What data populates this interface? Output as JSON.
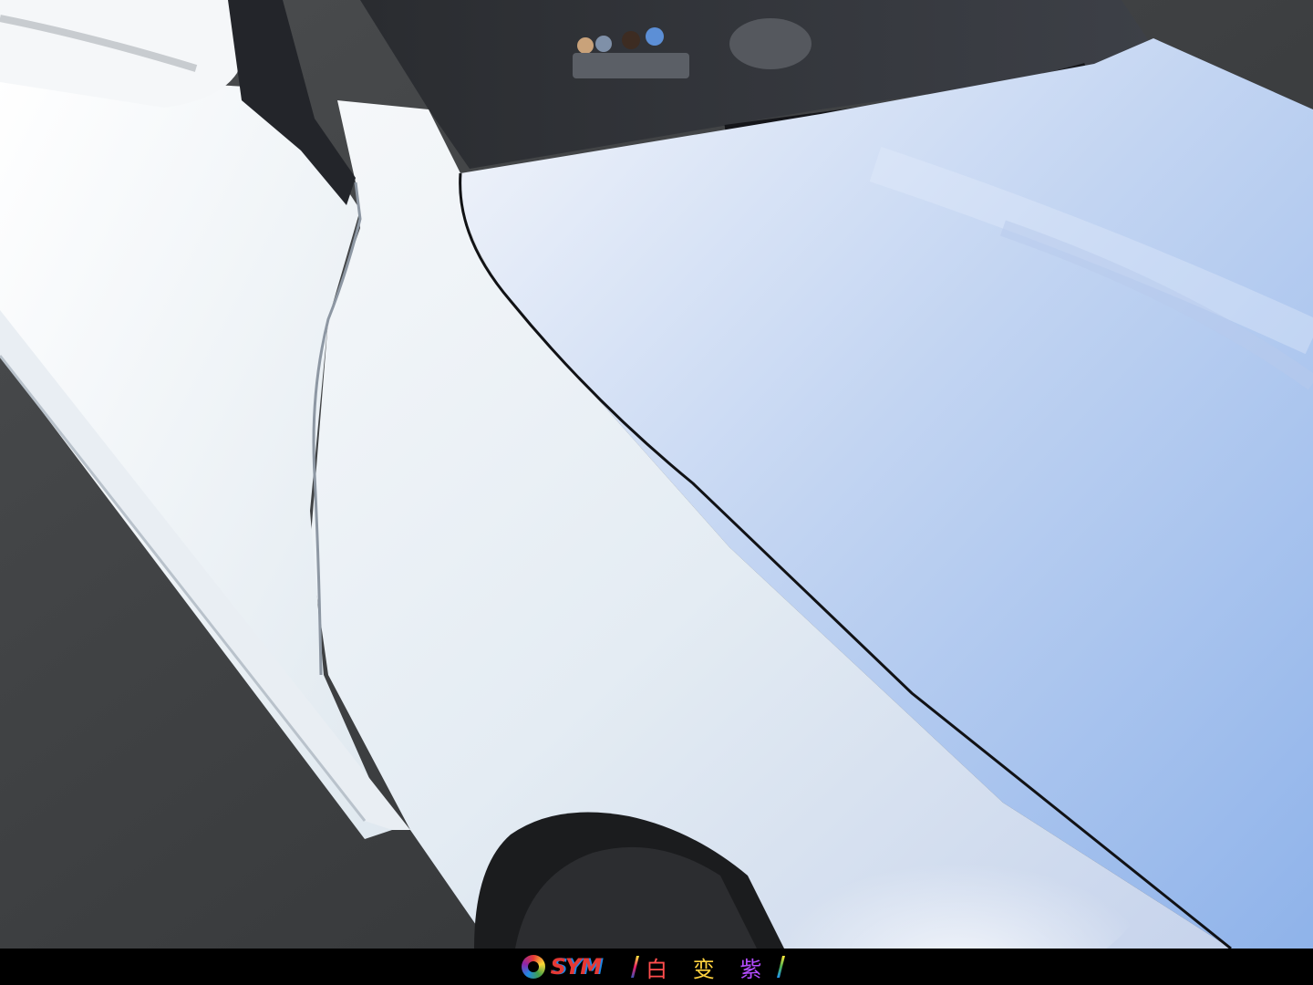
{
  "scene": {
    "description_icon": "white-car-fender-photo"
  },
  "footer": {
    "brand": "SYM",
    "tagline": [
      "白",
      "变",
      "紫"
    ],
    "colors": {
      "brand_red": "#e53935",
      "brand_blue": "#1e88e5",
      "char1": "#ff4d4d",
      "char2": "#ffd23f",
      "char3": "#b44cff"
    }
  }
}
